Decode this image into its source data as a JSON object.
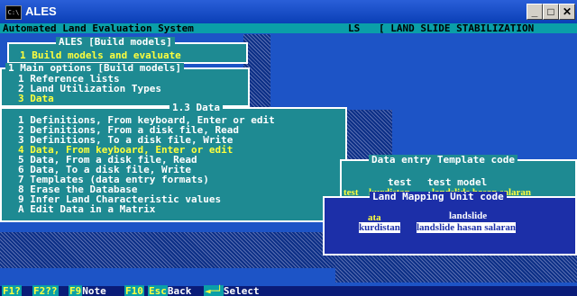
{
  "window": {
    "icon_text": "C:\\",
    "title": "ALES",
    "buttons": [
      "_",
      "□",
      "✕"
    ]
  },
  "header": {
    "system_name": "Automated Land Evaluation System",
    "model_code": "LS",
    "model_name": "[ LAND SLIDE STABILIZATION"
  },
  "menu_ales": {
    "title": "ALES [Build models]",
    "items": [
      "1 Build models and evaluate"
    ]
  },
  "menu_main": {
    "title": "1 Main options [Build models]",
    "items": [
      "1 Reference lists",
      "2 Land Utilization Types",
      "3 Data"
    ]
  },
  "menu_data": {
    "title": "1.3 Data",
    "items": [
      "1 Definitions, From keyboard, Enter or edit",
      "2 Definitions, From a disk file, Read",
      "3 Definitions, To a disk file, Write",
      "4 Data, From keyboard, Enter or edit",
      "5 Data, From a disk file, Read",
      "6 Data, To a disk file, Write",
      "7 Templates (data entry formats)",
      "8 Erase the Database",
      "9 Infer Land Characteristic values",
      "A Edit Data in a Matrix"
    ],
    "selected_index": 3
  },
  "template_panel": {
    "title": "Data entry Template code",
    "code": "test",
    "name": "test model",
    "row_code": "test",
    "row_item1": "kurdistan",
    "row_item2": "landslide hasan salaran"
  },
  "lmu_panel": {
    "title": "Land Mapping Unit code",
    "code": "ata",
    "name": "landslide",
    "sel_code": "kurdistan",
    "sel_name": "landslide hasan salaran"
  },
  "footer": {
    "keys": [
      {
        "key": "F1?",
        "label": ""
      },
      {
        "key": "F2??",
        "label": ""
      },
      {
        "key": "F9",
        "label": "Note"
      },
      {
        "key": "F10",
        "label": ""
      },
      {
        "key": "Esc",
        "label": "Back"
      },
      {
        "key": "◄─┘",
        "label": "Select"
      }
    ]
  }
}
